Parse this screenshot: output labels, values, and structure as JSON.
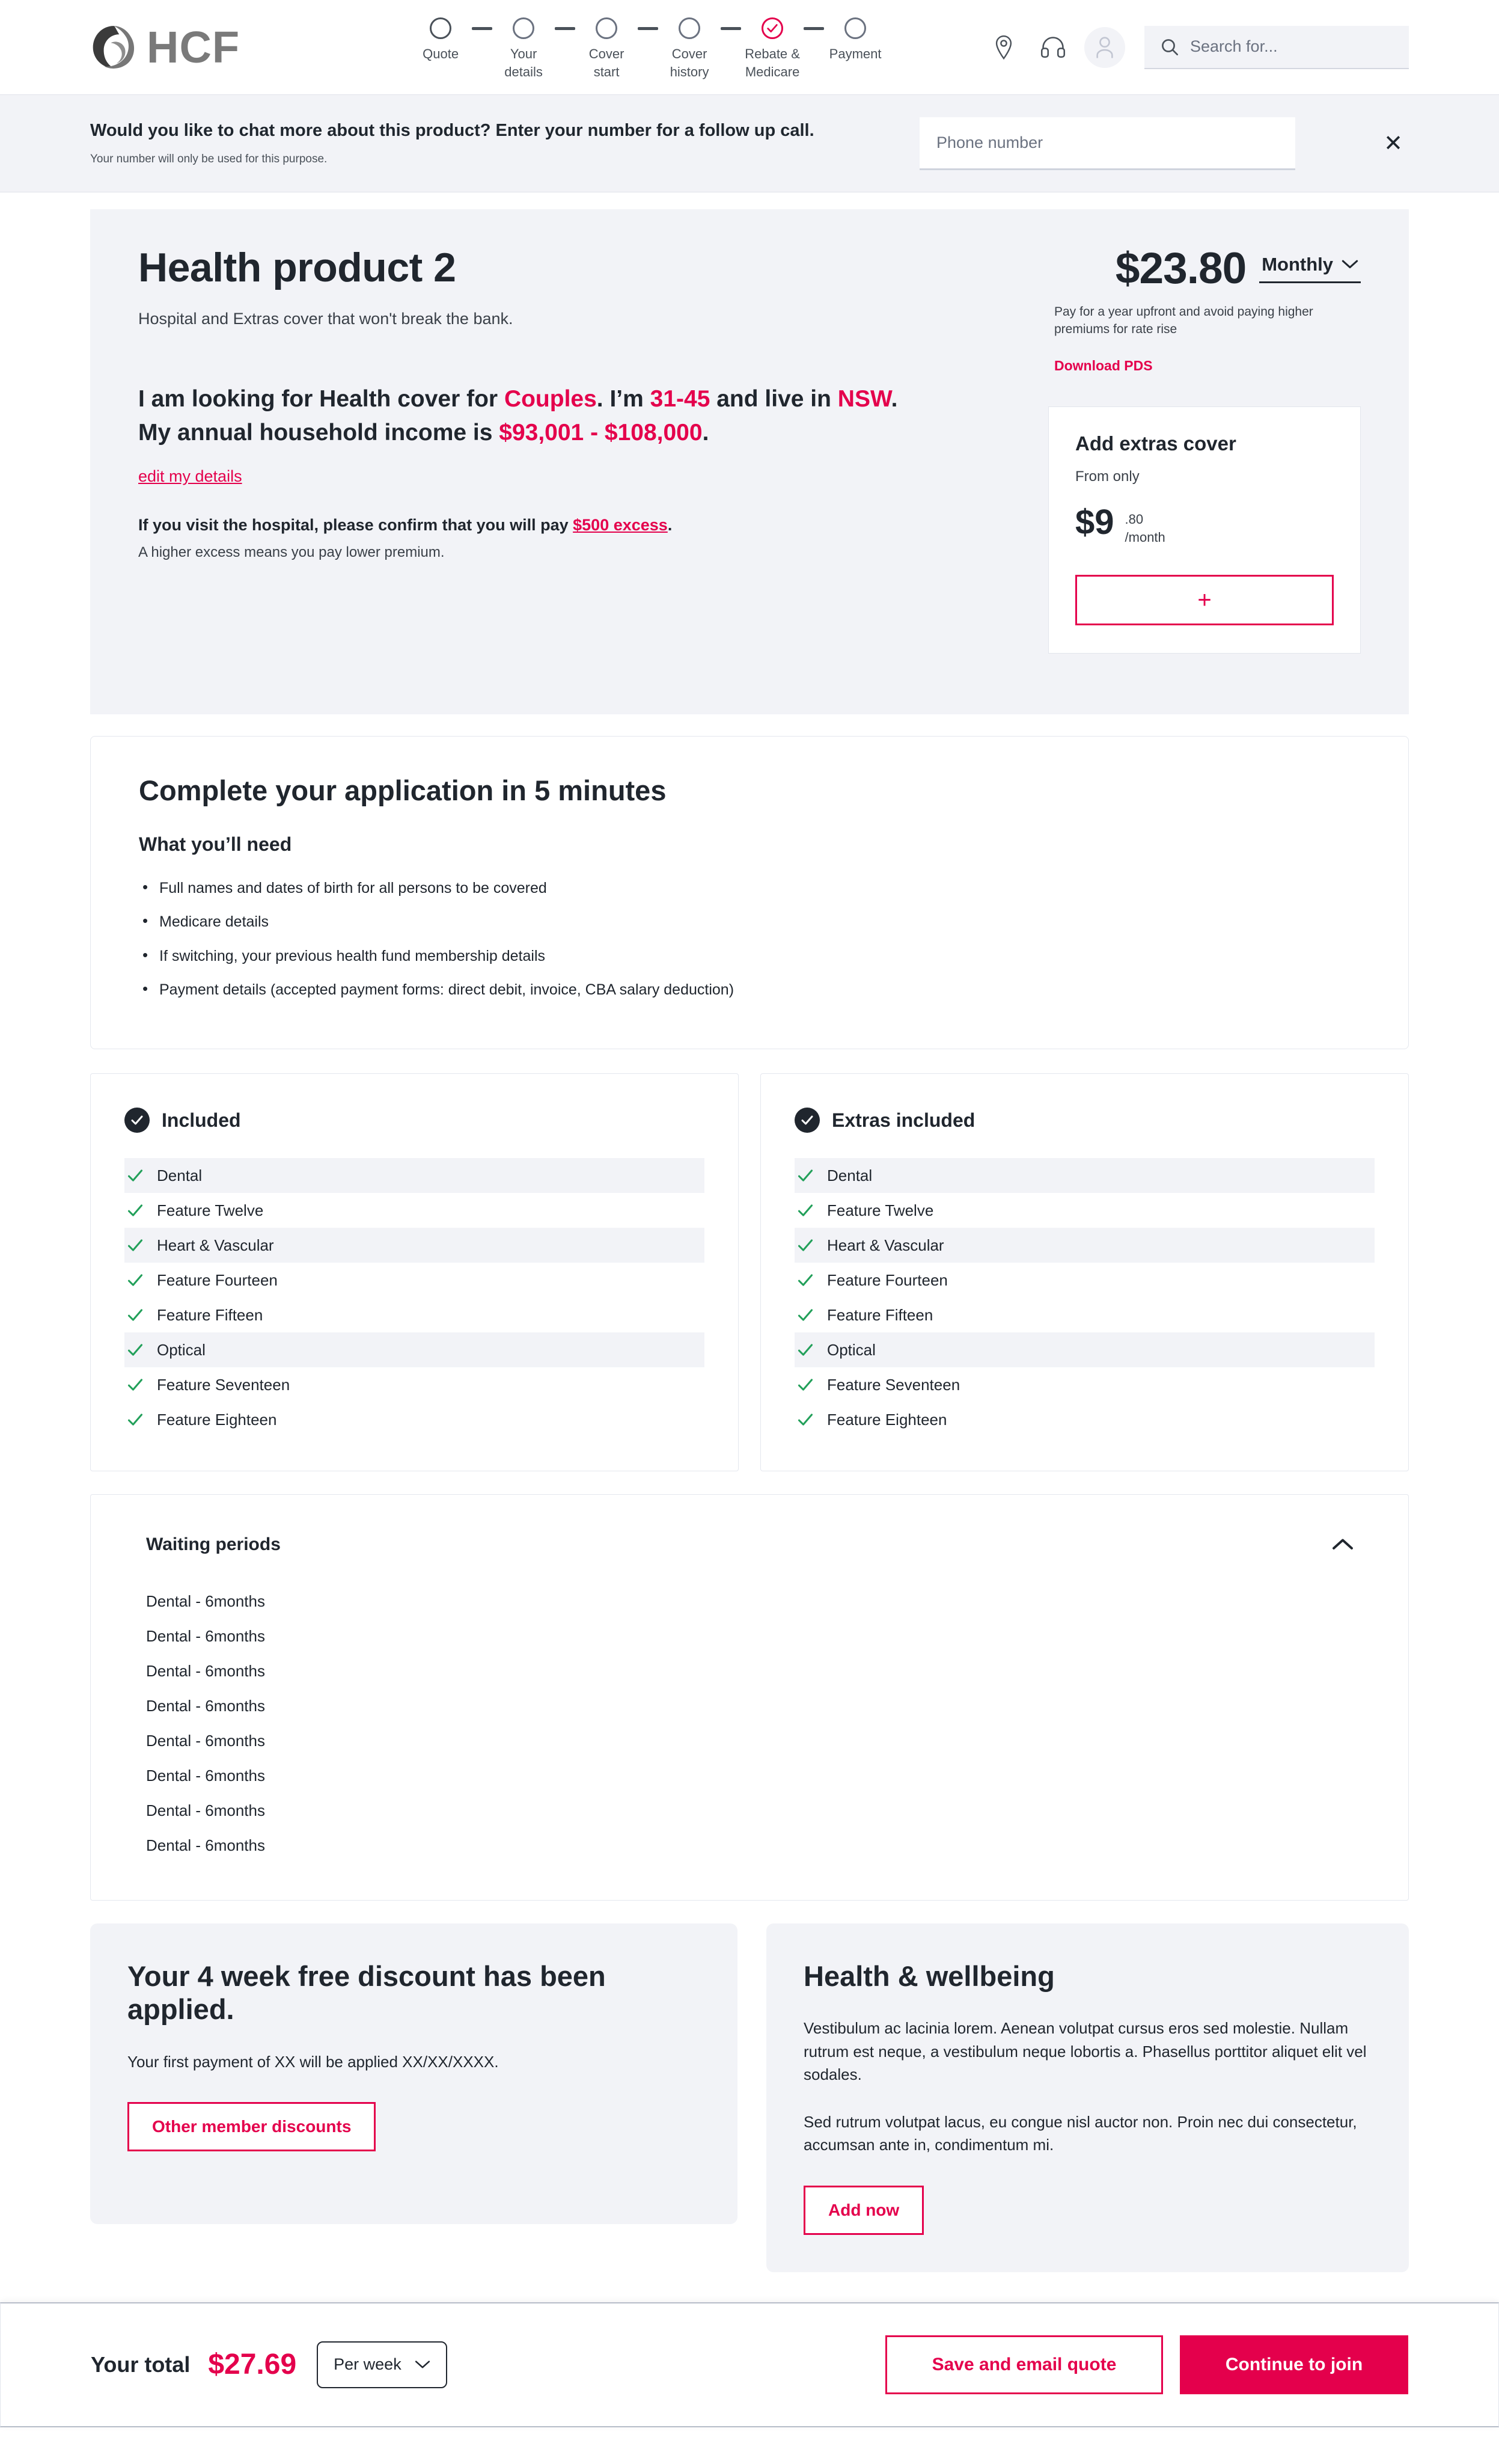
{
  "brand": {
    "logo_text": "HCF",
    "accent_color": "#e4004c",
    "dark_color": "#20262e",
    "surface_color": "#f2f3f7"
  },
  "header": {
    "steps": [
      {
        "label": "Quote",
        "state": "current"
      },
      {
        "label": "Your\ndetails",
        "state": "todo"
      },
      {
        "label": "Cover\nstart",
        "state": "todo"
      },
      {
        "label": "Cover\nhistory",
        "state": "todo"
      },
      {
        "label": "Rebate &\nMedicare",
        "state": "done"
      },
      {
        "label": "Payment",
        "state": "todo"
      }
    ],
    "icons": [
      "location-pin-icon",
      "headset-icon",
      "user-avatar-icon"
    ],
    "search": {
      "placeholder": "Search for...",
      "value": "",
      "icon": "search-icon"
    }
  },
  "banner": {
    "title": "Would you like to chat more about this product? Enter your number for a follow up call.",
    "subtitle": "Your number will only be used for this  purpose.",
    "phone_placeholder": "Phone number",
    "phone_value": "",
    "close_label": "✕"
  },
  "hero": {
    "title": "Health product 2",
    "subtitle": "Hospital and Extras cover that won't break the bank.",
    "statement": {
      "line1_a": "I am looking for Health cover for ",
      "line1_b": "Couples",
      "line1_c": ". I’m ",
      "line1_d": "31-45",
      "line1_e": " and live in ",
      "line1_f": "NSW",
      "line1_g": ".",
      "line2_a": "My annual household income is ",
      "line2_b": "$93,001 - $108,000",
      "line2_c": "."
    },
    "edit_link": "edit my details",
    "excess_a": "If you visit the hospital, please confirm that you will pay ",
    "excess_b": "$500 excess",
    "excess_c": ".",
    "excess_note": "A higher excess means you pay lower premium.",
    "price": "$23.80",
    "frequency": "Monthly",
    "price_note": "Pay for a year upfront and avoid paying higher premiums for rate rise",
    "pds_link": "Download PDS"
  },
  "extras_card": {
    "title": "Add extras cover",
    "from_label": "From only",
    "dollars": "$9",
    "cents": ".80",
    "period": "/month",
    "add_button": "+"
  },
  "application": {
    "title": "Complete your application in 5 minutes",
    "subtitle": "What you’ll need",
    "items": [
      "Full names and dates of birth for all persons to be covered",
      "Medicare details",
      "If switching, your previous health fund membership details",
      "Payment details (accepted payment forms: direct debit, invoice, CBA salary deduction)"
    ]
  },
  "panels": [
    {
      "title": "Included",
      "icon": "check-circle-icon",
      "features": [
        "Dental",
        "Feature Twelve",
        "Heart & Vascular",
        "Feature Fourteen",
        "Feature Fifteen",
        "Optical",
        "Feature Seventeen",
        "Feature Eighteen"
      ]
    },
    {
      "title": "Extras included",
      "icon": "check-circle-icon",
      "features": [
        "Dental",
        "Feature Twelve",
        "Heart & Vascular",
        "Feature Fourteen",
        "Feature Fifteen",
        "Optical",
        "Feature Seventeen",
        "Feature Eighteen"
      ]
    }
  ],
  "waiting": {
    "title": "Waiting periods",
    "toggle_icon": "chevron-up-icon",
    "items": [
      "Dental -  6months",
      "Dental -  6months",
      "Dental -  6months",
      "Dental -  6months",
      "Dental -  6months",
      "Dental -  6months",
      "Dental -  6months",
      "Dental -  6months"
    ]
  },
  "discount_card": {
    "title": "Your 4 week free discount has been applied.",
    "body": "Your first payment of XX will be applied XX/XX/XXXX.",
    "button": "Other member discounts"
  },
  "wellbeing_card": {
    "title": "Health & wellbeing",
    "body1": "Vestibulum ac lacinia lorem. Aenean volutpat cursus eros sed molestie. Nullam rutrum est neque, a vestibulum neque lobortis a. Phasellus porttitor aliquet elit vel sodales.",
    "body2": "Sed rutrum volutpat lacus, eu congue nisl auctor non. Proin nec dui consectetur, accumsan ante in, condimentum mi.",
    "button": "Add now"
  },
  "total_bar": {
    "label": "Your total",
    "amount": "$27.69",
    "period": "Per week",
    "save_button": "Save and email quote",
    "continue_button": "Continue to join"
  }
}
